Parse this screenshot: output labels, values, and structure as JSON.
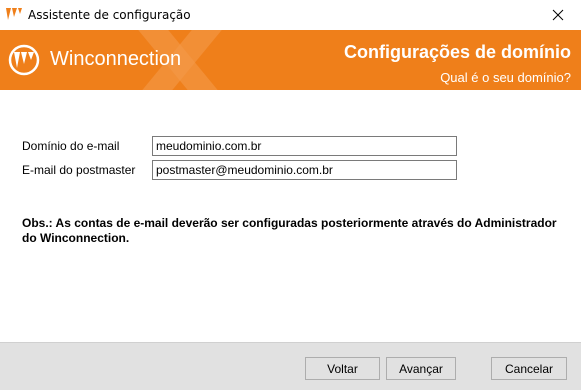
{
  "window": {
    "title": "Assistente de configuração",
    "close_icon": "close-icon"
  },
  "banner": {
    "brand": "Winconnection",
    "title": "Configurações de domínio",
    "subtitle": "Qual é o seu domínio?",
    "color": "#ef7f1a"
  },
  "form": {
    "domain_label": "Domínio do e-mail",
    "domain_value": "meudominio.com.br",
    "postmaster_label": "E-mail do postmaster",
    "postmaster_value": "postmaster@meudominio.com.br"
  },
  "note": "Obs.: As contas de e-mail deverão ser configuradas posteriormente através do Administrador do Winconnection.",
  "buttons": {
    "back": "Voltar",
    "next": "Avançar",
    "cancel": "Cancelar"
  }
}
